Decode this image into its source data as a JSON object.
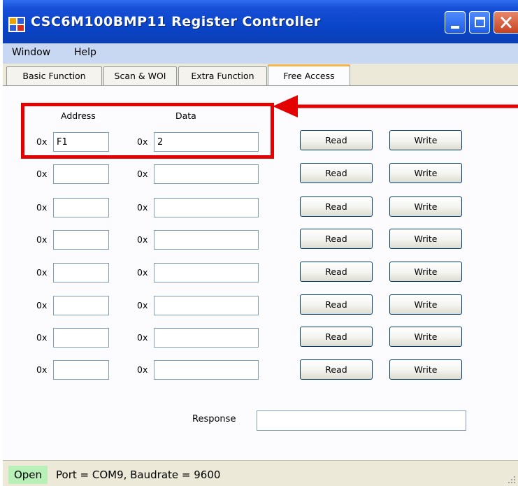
{
  "window": {
    "title": "CSC6M100BMP11 Register Controller"
  },
  "menu": {
    "items": [
      {
        "label": "Window"
      },
      {
        "label": "Help"
      }
    ]
  },
  "tabs": [
    {
      "label": "Basic Function",
      "active": false
    },
    {
      "label": "Scan & WOI",
      "active": false
    },
    {
      "label": "Extra Function",
      "active": false
    },
    {
      "label": "Free Access",
      "active": true
    }
  ],
  "free_access": {
    "address_header": "Address",
    "data_header": "Data",
    "prefix": "0x",
    "read_label": "Read",
    "write_label": "Write",
    "rows": [
      {
        "address": "F1",
        "data": "2"
      },
      {
        "address": "",
        "data": ""
      },
      {
        "address": "",
        "data": ""
      },
      {
        "address": "",
        "data": ""
      },
      {
        "address": "",
        "data": ""
      },
      {
        "address": "",
        "data": ""
      },
      {
        "address": "",
        "data": ""
      },
      {
        "address": "",
        "data": ""
      }
    ],
    "response_label": "Response",
    "response_value": ""
  },
  "status": {
    "state": "Open",
    "text": "Port = COM9,  Baudrate = 9600"
  },
  "colors": {
    "annotation": "#e30000",
    "status_open_bg": "#b8f0b8",
    "titlebar": "#0a44c8"
  },
  "icons": {
    "app": "app-icon",
    "minimize": "minimize-icon",
    "maximize": "maximize-icon",
    "close": "close-icon",
    "annotation_arrow": "arrow-left-icon"
  }
}
